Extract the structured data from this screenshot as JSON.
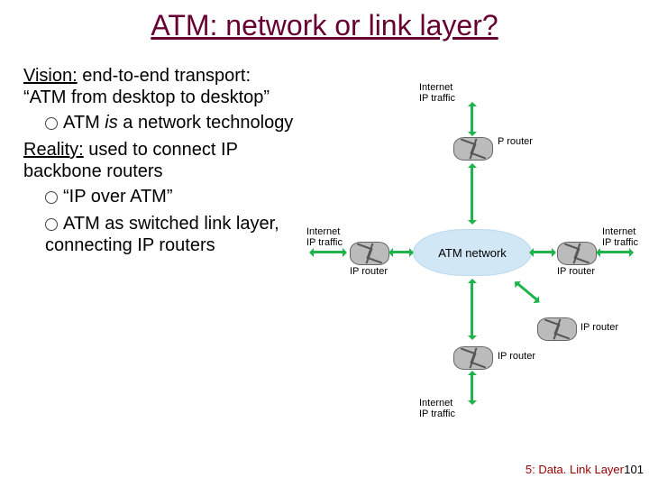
{
  "title": "ATM:  network or link layer?",
  "body": {
    "vision_lead": "Vision:",
    "vision_rest": " end-to-end transport: “ATM from desktop to desktop”",
    "vision_sub": "ATM ",
    "vision_sub_italic": "is",
    "vision_sub_rest": " a network technology",
    "reality_lead": "Reality:",
    "reality_rest": " used to connect IP backbone routers",
    "reality_sub1": "“IP over ATM”",
    "reality_sub2": "ATM as switched link layer, connecting IP routers"
  },
  "figure": {
    "atm_network": "ATM network",
    "internet_ip_traffic": "Internet\nIP traffic",
    "p_router": "P router",
    "ip_router": "IP router"
  },
  "footer": "5: Data. Link Layer",
  "pagenum": "101"
}
